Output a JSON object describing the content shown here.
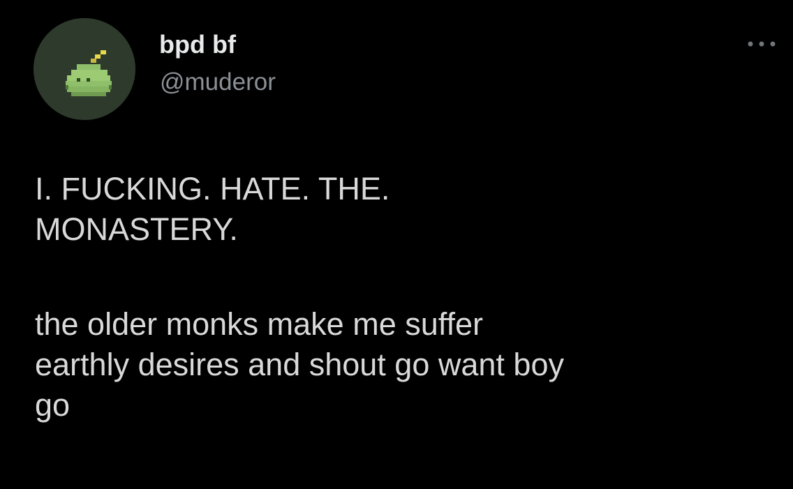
{
  "author": {
    "display_name": "bpd bf",
    "handle": "@muderor",
    "avatar_icon": "green-blob-pixel-avatar",
    "avatar_bg": "#2e3a2c"
  },
  "menu": {
    "more_icon": "more-options-icon"
  },
  "tweet": {
    "headline": "I. FUCKING. HATE. THE.\nMONASTERY.",
    "body": "the older monks make me suffer\nearthly desires and shout go want boy\ngo"
  },
  "colors": {
    "background": "#000000",
    "primary_text": "#e7e9ea",
    "secondary_text": "#8b9096"
  }
}
